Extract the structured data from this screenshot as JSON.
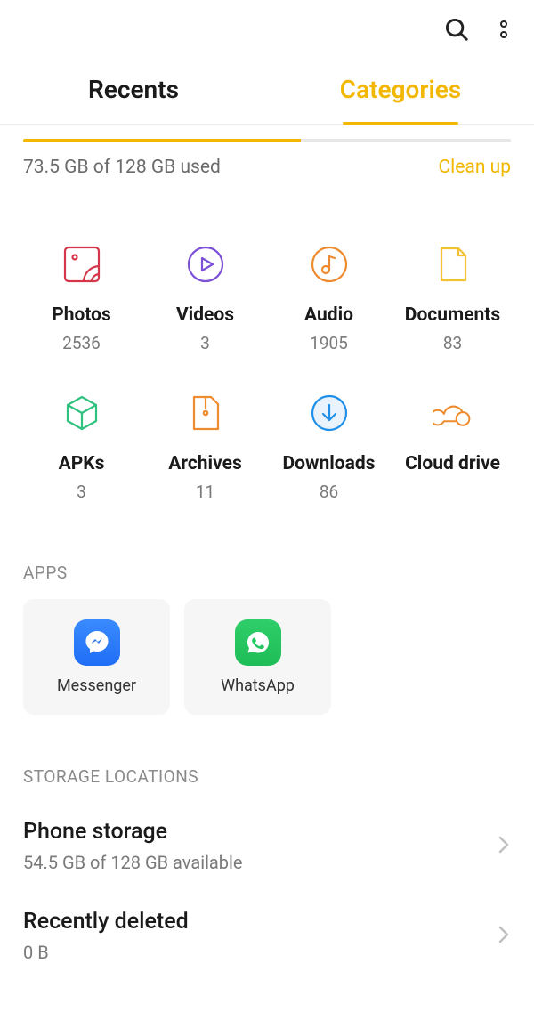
{
  "tabs": {
    "recents": "Recents",
    "categories": "Categories"
  },
  "storage": {
    "used_text": "73.5 GB of 128 GB used",
    "cleanup_label": "Clean up",
    "used_pct": 57
  },
  "categories": [
    {
      "key": "photos",
      "label": "Photos",
      "count": "2536"
    },
    {
      "key": "videos",
      "label": "Videos",
      "count": "3"
    },
    {
      "key": "audio",
      "label": "Audio",
      "count": "1905"
    },
    {
      "key": "documents",
      "label": "Documents",
      "count": "83"
    },
    {
      "key": "apks",
      "label": "APKs",
      "count": "3"
    },
    {
      "key": "archives",
      "label": "Archives",
      "count": "11"
    },
    {
      "key": "downloads",
      "label": "Downloads",
      "count": "86"
    },
    {
      "key": "cloud",
      "label": "Cloud drive",
      "count": ""
    }
  ],
  "apps_header": "APPS",
  "apps": [
    {
      "key": "messenger",
      "name": "Messenger"
    },
    {
      "key": "whatsapp",
      "name": "WhatsApp"
    }
  ],
  "storage_locations_header": "STORAGE LOCATIONS",
  "locations": [
    {
      "key": "phone",
      "title": "Phone storage",
      "sub": "54.5 GB of 128 GB available"
    },
    {
      "key": "recent_del",
      "title": "Recently deleted",
      "sub": "0 B"
    }
  ]
}
